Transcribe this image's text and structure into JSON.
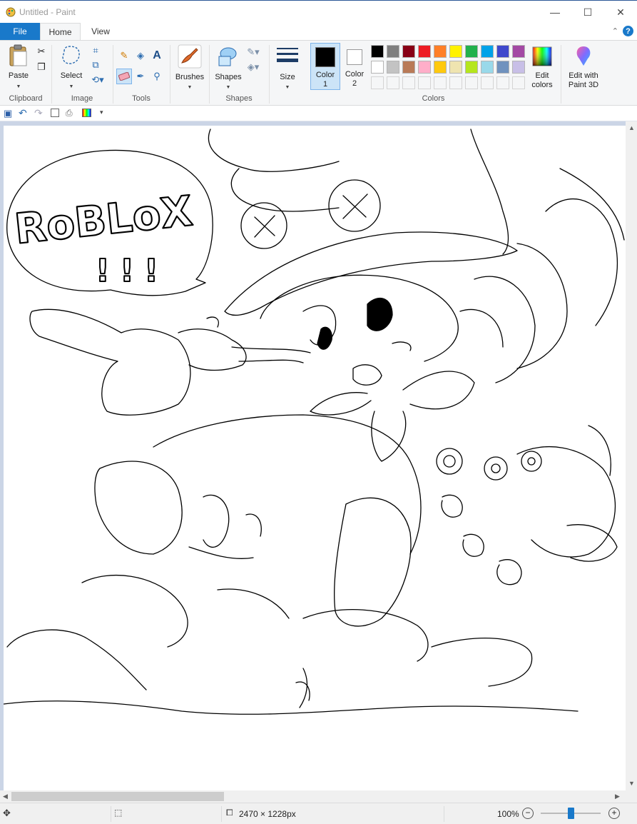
{
  "window": {
    "title": "Untitled - Paint",
    "minimize_glyph": "—",
    "maximize_glyph": "☐",
    "close_glyph": "✕"
  },
  "tabs": {
    "file": "File",
    "home": "Home",
    "view": "View"
  },
  "ribbon": {
    "clipboard": {
      "group": "Clipboard",
      "paste": "Paste"
    },
    "image": {
      "group": "Image",
      "select": "Select"
    },
    "tools": {
      "group": "Tools",
      "text_glyph": "A"
    },
    "brushes": {
      "label": "Brushes"
    },
    "shapes": {
      "group": "Shapes",
      "label": "Shapes"
    },
    "size": {
      "label": "Size"
    },
    "colors": {
      "group": "Colors",
      "color1_line1": "Color",
      "color1_line2": "1",
      "color2_line1": "Color",
      "color2_line2": "2",
      "edit_line1": "Edit",
      "edit_line2": "colors",
      "color1_value": "#000000",
      "color2_value": "#ffffff",
      "palette_row1": [
        "#000000",
        "#7f7f7f",
        "#880015",
        "#ed1c24",
        "#ff7f27",
        "#fff200",
        "#22b14c",
        "#00a2e8",
        "#3f48cc",
        "#a349a4"
      ],
      "palette_row2": [
        "#ffffff",
        "#c3c3c3",
        "#b97a57",
        "#ffaec9",
        "#ffc90e",
        "#efe4b0",
        "#b5e61d",
        "#99d9ea",
        "#7092be",
        "#c8bfe7"
      ]
    },
    "paint3d": {
      "line1": "Edit with",
      "line2": "Paint 3D"
    }
  },
  "status": {
    "image_size": "2470 × 1228px",
    "zoom": "100%",
    "zoom_out": "−",
    "zoom_in": "+",
    "zoom_level": 0.5
  },
  "canvas_text": {
    "speech_bubble": "RoBLoX",
    "exclaim": "!!!"
  }
}
